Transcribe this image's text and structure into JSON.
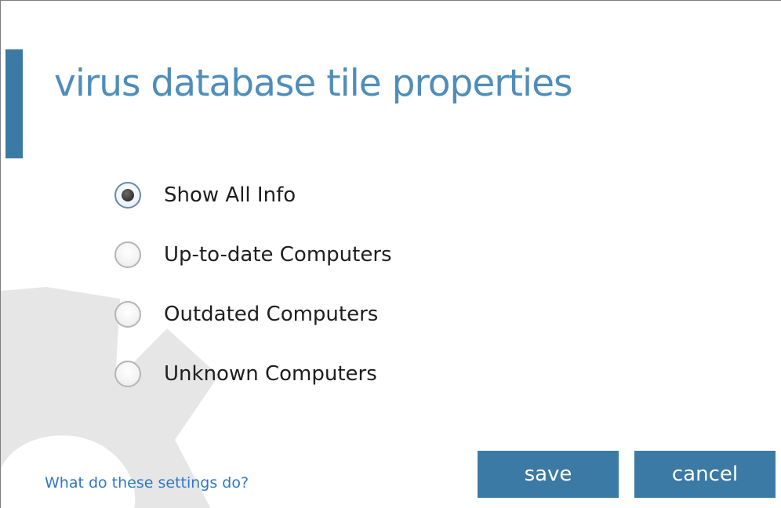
{
  "dialog": {
    "title": "virus database tile properties"
  },
  "options": [
    {
      "label": "Show All Info",
      "selected": true
    },
    {
      "label": "Up-to-date Computers",
      "selected": false
    },
    {
      "label": "Outdated Computers",
      "selected": false
    },
    {
      "label": "Unknown Computers",
      "selected": false
    }
  ],
  "footer": {
    "help_link": "What do these settings do?",
    "save_label": "save",
    "cancel_label": "cancel"
  },
  "colors": {
    "accent": "#3b7aa5",
    "title": "#4f8dba",
    "link": "#2f78c4",
    "gear_watermark": "#e6e6e6"
  },
  "icons": {
    "watermark": "gear-icon"
  }
}
